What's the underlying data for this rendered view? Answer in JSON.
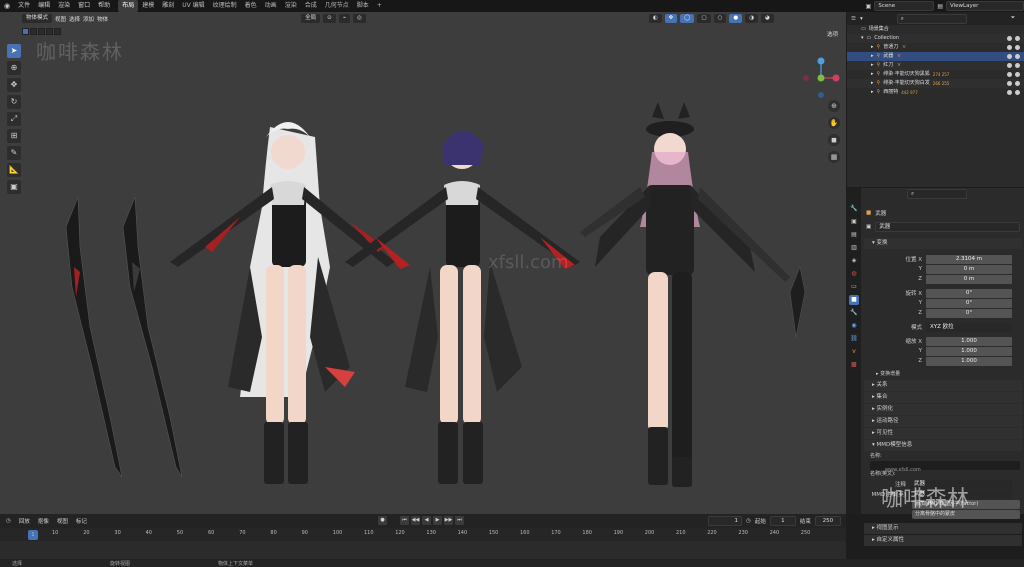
{
  "topbar": {
    "menus": [
      "文件",
      "编辑",
      "渲染",
      "窗口",
      "帮助"
    ],
    "workspaces": [
      {
        "label": "布局",
        "active": true
      },
      {
        "label": "建模",
        "active": false
      },
      {
        "label": "雕刻",
        "active": false
      },
      {
        "label": "UV 编辑",
        "active": false
      },
      {
        "label": "纹理绘制",
        "active": false
      },
      {
        "label": "着色",
        "active": false
      },
      {
        "label": "动画",
        "active": false
      },
      {
        "label": "渲染",
        "active": false
      },
      {
        "label": "合成",
        "active": false
      },
      {
        "label": "几何节点",
        "active": false
      },
      {
        "label": "脚本",
        "active": false
      }
    ],
    "add_tab": "+",
    "scene_label": "Scene",
    "view_layer_label": "ViewLayer"
  },
  "viewport": {
    "mode": "物体模式",
    "menus": [
      "视图",
      "选择",
      "添加",
      "物体"
    ],
    "transform_orientation": "全局",
    "options_label": "选项",
    "watermark_tl": "咖啡森林",
    "watermark_center": "xfsll.com"
  },
  "outliner": {
    "title": "场景集合",
    "rows": [
      {
        "label": "Collection",
        "depth": 1,
        "selected": false
      },
      {
        "label": "普通刀",
        "depth": 2,
        "selected": false,
        "extra": ""
      },
      {
        "label": "武器",
        "depth": 2,
        "selected": true,
        "extra": ""
      },
      {
        "label": "红刀",
        "depth": 2,
        "selected": false,
        "extra": ""
      },
      {
        "label": "绯染·丰能切天狗黑狐",
        "depth": 2,
        "selected": false,
        "extra": "274 257"
      },
      {
        "label": "绯染·丰能切天狗白发",
        "depth": 2,
        "selected": false,
        "extra": "266 255"
      },
      {
        "label": "西丽特",
        "depth": 2,
        "selected": false,
        "extra": "442 977"
      }
    ]
  },
  "properties": {
    "object_name": "武器",
    "data_name": "武器",
    "transform_section": "变换",
    "location": {
      "label": "位置 X",
      "x": "2.3104 m",
      "y": "0 m",
      "z": "0 m"
    },
    "rotation": {
      "label": "旋转 X",
      "x": "0°",
      "y": "0°",
      "z": "0°"
    },
    "mode": {
      "label": "模式",
      "value": "XYZ 欧拉"
    },
    "scale": {
      "label": "缩放 X",
      "x": "1.000",
      "y": "1.000",
      "z": "1.000"
    },
    "axis_y": "Y",
    "axis_z": "Z",
    "delta_section": "变换增量",
    "sections": [
      "关系",
      "集合",
      "实例化",
      "运动路径",
      "可见性"
    ],
    "mmd_section": "MMD模型信息",
    "mmd_name_label": "名称:",
    "mmd_name_en_label": "名称(英文):",
    "mmd_rows": [
      {
        "label": "注释",
        "value": "武器"
      },
      {
        "label": "MMD注释(英)",
        "value": "武器"
      }
    ],
    "mmd_btn1": "添加MMD 纹理因子(Factor)",
    "mmd_btn2": "分离骨骼中的蒙皮",
    "bottom_sections": [
      "视图显示",
      "自定义属性"
    ]
  },
  "logo": {
    "text": "咖啡森林",
    "sub": "www.xfsll.com"
  },
  "timeline": {
    "menus": [
      "回放",
      "抠像",
      "视图",
      "标记"
    ],
    "current_frame": "1",
    "start_label": "起始",
    "start": "1",
    "end_label": "结束",
    "end": "250",
    "ticks": [
      "1",
      "10",
      "20",
      "30",
      "40",
      "50",
      "60",
      "70",
      "80",
      "90",
      "100",
      "110",
      "120",
      "130",
      "140",
      "150",
      "160",
      "170",
      "180",
      "190",
      "200",
      "210",
      "220",
      "230",
      "240",
      "250"
    ]
  },
  "status": [
    "选择",
    "旋转视图",
    "物体上下文菜单"
  ],
  "colors": {
    "accent": "#4772b3",
    "selected_row": "#334d80",
    "panel": "#2b2b2b",
    "viewport": "#3d3d3d"
  }
}
